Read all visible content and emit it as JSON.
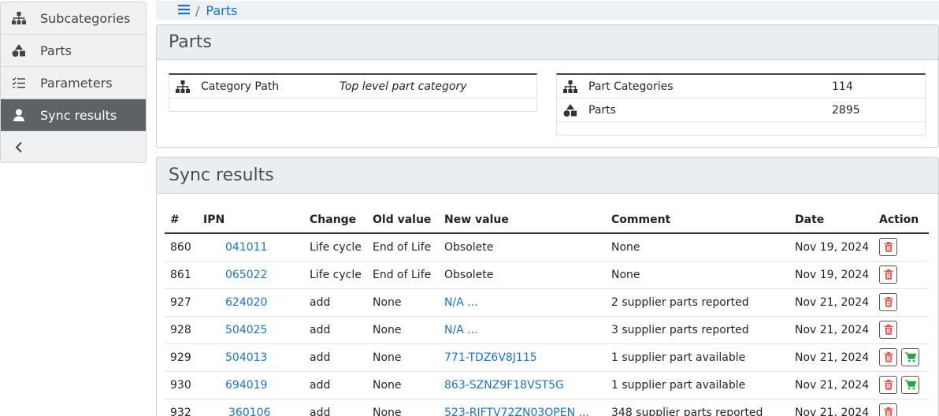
{
  "sidebar": {
    "items": [
      {
        "label": "Subcategories",
        "icon": "sitemap-icon"
      },
      {
        "label": "Parts",
        "icon": "shapes-icon"
      },
      {
        "label": "Parameters",
        "icon": "list-check-icon"
      },
      {
        "label": "Sync results",
        "icon": "user-icon",
        "active": true
      }
    ],
    "collapse_icon": "chevron-left-icon"
  },
  "breadcrumb": {
    "menu_icon": "hamburger-icon",
    "separator": "/",
    "current": "Parts"
  },
  "parts_panel": {
    "title": "Parts",
    "category_path_label": "Category Path",
    "category_path_value": "Top level part category",
    "stats": [
      {
        "label": "Part Categories",
        "value": "114",
        "icon": "sitemap-icon"
      },
      {
        "label": "Parts",
        "value": "2895",
        "icon": "shapes-icon"
      }
    ]
  },
  "sync_panel": {
    "title": "Sync results",
    "columns": [
      "#",
      "IPN",
      "Change",
      "Old value",
      "New value",
      "Comment",
      "Date",
      "Action"
    ],
    "rows": [
      {
        "id": "860",
        "ipn": "041011",
        "change": "Life cycle",
        "old": "End of Life",
        "new": "Obsolete",
        "new_link": false,
        "comment": "None",
        "date": "Nov 19, 2024",
        "cart": false
      },
      {
        "id": "861",
        "ipn": "065022",
        "change": "Life cycle",
        "old": "End of Life",
        "new": "Obsolete",
        "new_link": false,
        "comment": "None",
        "date": "Nov 19, 2024",
        "cart": false
      },
      {
        "id": "927",
        "ipn": "624020",
        "change": "add",
        "old": "None",
        "new": "N/A ...",
        "new_link": true,
        "comment": "2 supplier parts reported",
        "date": "Nov 21, 2024",
        "cart": false
      },
      {
        "id": "928",
        "ipn": "504025",
        "change": "add",
        "old": "None",
        "new": "N/A ...",
        "new_link": true,
        "comment": "3 supplier parts reported",
        "date": "Nov 21, 2024",
        "cart": false
      },
      {
        "id": "929",
        "ipn": "504013",
        "change": "add",
        "old": "None",
        "new": "771-TDZ6V8J115",
        "new_link": true,
        "comment": "1 supplier part available",
        "date": "Nov 21, 2024",
        "cart": true
      },
      {
        "id": "930",
        "ipn": "694019",
        "change": "add",
        "old": "None",
        "new": "863-SZNZ9F18VST5G",
        "new_link": true,
        "comment": "1 supplier part available",
        "date": "Nov 21, 2024",
        "cart": true
      },
      {
        "id": "932",
        "ipn": "360106",
        "change": "add",
        "old": "None",
        "new": "523-RJFTV72ZN03OPEN ...",
        "new_link": true,
        "comment": "348 supplier parts reported",
        "date": "Nov 21, 2024",
        "cart": false
      }
    ]
  },
  "colors": {
    "link": "#1a73c9",
    "delete": "#d9534f",
    "cart": "#28a745",
    "active_bg": "#5e6166"
  }
}
